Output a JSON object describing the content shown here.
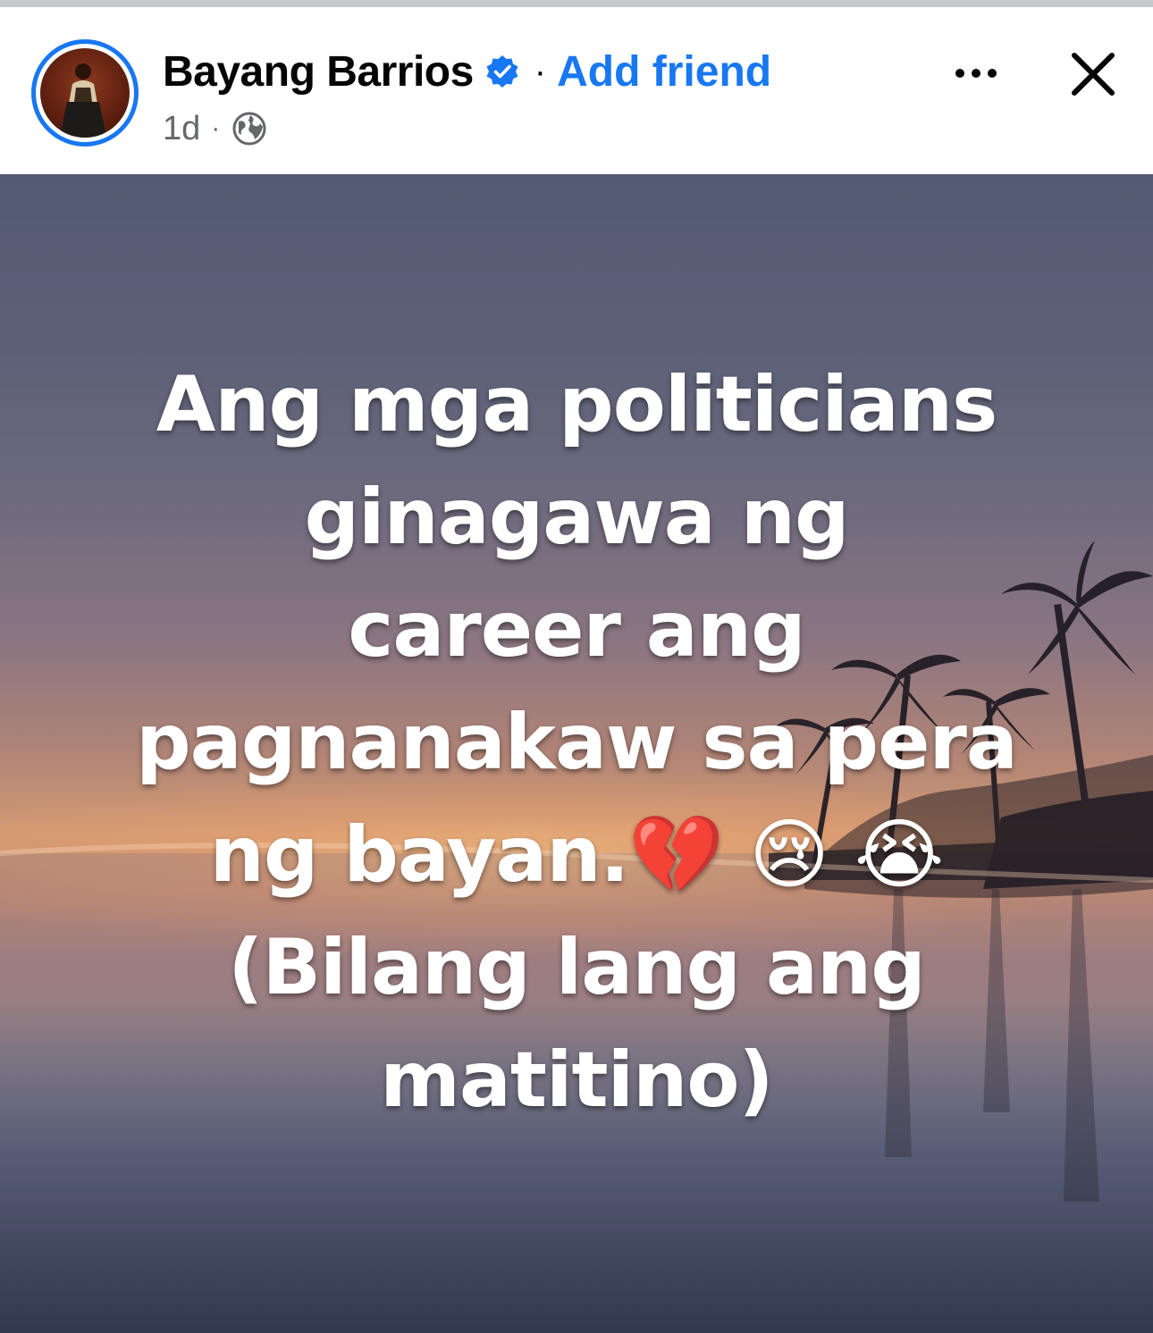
{
  "post": {
    "author": "Bayang Barrios",
    "separator": "·",
    "add_friend": "Add friend",
    "time": "1d",
    "meta_separator": "·",
    "verified_icon": "verified-badge-icon",
    "privacy_icon": "globe-icon",
    "more_icon": "more-options-icon",
    "close_icon": "close-icon",
    "accent_color": "#1877f2"
  },
  "image_text": {
    "lines": [
      "Ang mga politicians",
      "ginagawa ng",
      "career ang",
      "pagnanakaw sa pera",
      "ng bayan.💔 😢 😭",
      "(Bilang lang ang",
      "matitino)"
    ]
  }
}
